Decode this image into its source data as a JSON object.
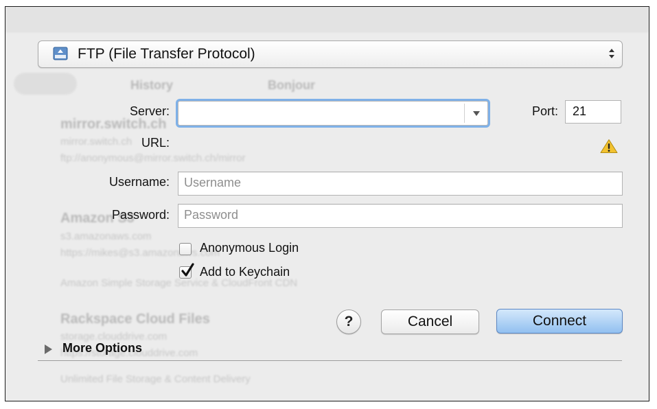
{
  "protocol_select": {
    "value": "FTP (File Transfer Protocol)",
    "icon": "ftp-drive-icon"
  },
  "labels": {
    "server": "Server:",
    "port": "Port:",
    "url": "URL:",
    "username": "Username:",
    "password": "Password:"
  },
  "server": {
    "value": "",
    "placeholder": ""
  },
  "port": {
    "value": "21"
  },
  "username": {
    "value": "",
    "placeholder": "Username"
  },
  "password": {
    "value": "",
    "placeholder": "Password"
  },
  "checkboxes": {
    "anonymous_login": {
      "label": "Anonymous Login",
      "checked": false
    },
    "add_to_keychain": {
      "label": "Add to Keychain",
      "checked": true
    }
  },
  "buttons": {
    "help": "?",
    "cancel": "Cancel",
    "connect": "Connect"
  },
  "more_options": {
    "label": "More Options"
  },
  "background_bookmarks": {
    "tabs": [
      "History",
      "Bonjour"
    ],
    "items": [
      {
        "title": "mirror.switch.ch",
        "line1": "mirror.switch.ch",
        "line2": "ftp://anonymous@mirror.switch.ch/mirror"
      },
      {
        "title": "Amazon S3",
        "line1": "s3.amazonaws.com",
        "line2": "https://mikes@s3.amazonaws.com",
        "line3": "Amazon Simple Storage Service & CloudFront CDN"
      },
      {
        "title": "Rackspace Cloud Files",
        "line1": "storage.clouddrive.com",
        "line2": "https://storage.clouddrive.com",
        "line3": "Unlimited File Storage & Content Delivery"
      }
    ]
  },
  "colors": {
    "focus_ring": "#7fb1e8",
    "primary_button": "#92c0f0",
    "warning": "#f2c230"
  }
}
